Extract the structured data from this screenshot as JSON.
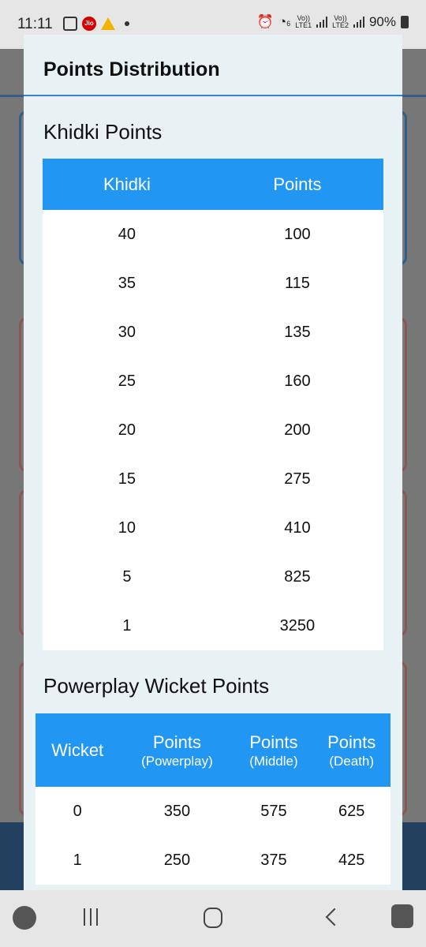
{
  "status_bar": {
    "time": "11:11",
    "jio_label": "Jio",
    "volte1_top": "Vo))",
    "volte1_bottom": "LTE1",
    "volte2_top": "Vo))",
    "volte2_bottom": "LTE2",
    "wifi_label": "6",
    "battery": "90%"
  },
  "dialog": {
    "title": "Points Distribution",
    "khidki_section": {
      "title": "Khidki Points",
      "headers": [
        "Khidki",
        "Points"
      ],
      "rows": [
        [
          "40",
          "100"
        ],
        [
          "35",
          "115"
        ],
        [
          "30",
          "135"
        ],
        [
          "25",
          "160"
        ],
        [
          "20",
          "200"
        ],
        [
          "15",
          "275"
        ],
        [
          "10",
          "410"
        ],
        [
          "5",
          "825"
        ],
        [
          "1",
          "3250"
        ]
      ]
    },
    "wicket_section": {
      "title": "Powerplay Wicket Points",
      "headers": [
        {
          "label": "Wicket",
          "sub": ""
        },
        {
          "label": "Points",
          "sub": "(Powerplay)"
        },
        {
          "label": "Points",
          "sub": "(Middle)"
        },
        {
          "label": "Points",
          "sub": "(Death)"
        }
      ],
      "rows": [
        [
          "0",
          "350",
          "575",
          "625"
        ],
        [
          "1",
          "250",
          "375",
          "425"
        ]
      ]
    }
  },
  "nav_bar": {
    "icons": [
      "game-launcher-icon",
      "recent-apps-icon",
      "home-icon",
      "back-icon",
      "assistant-icon"
    ]
  }
}
